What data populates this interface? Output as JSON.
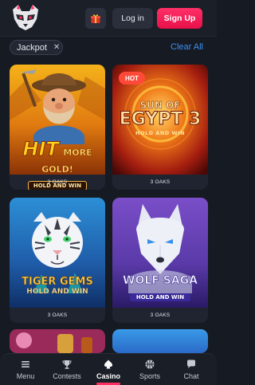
{
  "header": {
    "login_label": "Log in",
    "signup_label": "Sign Up",
    "accent_color": "#ff2f62"
  },
  "filters": {
    "chip_label": "Jackpot",
    "clear_label": "Clear All"
  },
  "games": [
    {
      "id": "hit-more-gold",
      "title_line1": "HIT",
      "title_line2": "MORE GOLD!",
      "subtitle": "HOLD AND WIN",
      "provider": "3 OAKS",
      "badge": ""
    },
    {
      "id": "sun-of-egypt-3",
      "title_line1": "SUN OF",
      "title_line2": "EGYPT 3",
      "subtitle": "HOLD AND WIN",
      "provider": "3 OAKS",
      "badge": "HOT"
    },
    {
      "id": "tiger-gems",
      "title_line1": "TIGER GEMS",
      "title_line2": "",
      "subtitle": "HOLD AND WIN",
      "provider": "3 OAKS",
      "badge": ""
    },
    {
      "id": "wolf-saga",
      "title_line1": "WOLF SAGA",
      "title_line2": "",
      "subtitle": "HOLD AND WIN",
      "provider": "3 OAKS",
      "badge": ""
    }
  ],
  "bottom_nav": {
    "items": [
      {
        "label": "Menu",
        "icon": "menu-icon"
      },
      {
        "label": "Contests",
        "icon": "trophy-icon"
      },
      {
        "label": "Casino",
        "icon": "spade-icon",
        "active": true
      },
      {
        "label": "Sports",
        "icon": "basketball-icon"
      },
      {
        "label": "Chat",
        "icon": "chat-icon"
      }
    ]
  }
}
